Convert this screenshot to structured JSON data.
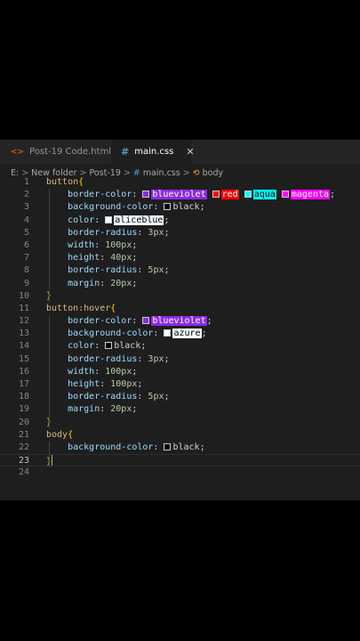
{
  "tabs": [
    {
      "icon": "<>",
      "label": "Post-19 Code.html",
      "active": false
    },
    {
      "icon": "#",
      "label": "main.css",
      "active": true,
      "close": "✕"
    }
  ],
  "breadcrumb": {
    "items": [
      "E:",
      "New folder",
      "Post-19",
      "main.css",
      "body"
    ],
    "separator": ">"
  },
  "colors": {
    "blueviolet": "#8a2be2",
    "red": "#ff0000",
    "aqua": "#00ffff",
    "magenta": "#ff00ff",
    "black": "#000000",
    "aliceblue": "#f0f8ff",
    "azure": "#f0ffff"
  },
  "code_lines": [
    {
      "n": "1",
      "tokens": [
        [
          "sel",
          "button"
        ],
        [
          "br",
          "{"
        ]
      ]
    },
    {
      "n": "2",
      "tokens": [
        [
          "ind",
          "    "
        ],
        [
          "prop",
          "border-color"
        ],
        [
          "pun",
          ": "
        ],
        [
          "color",
          "blueviolet"
        ],
        [
          "pun",
          " "
        ],
        [
          "color",
          "red"
        ],
        [
          "pun",
          " "
        ],
        [
          "color",
          "aqua"
        ],
        [
          "pun",
          " "
        ],
        [
          "color",
          "magenta"
        ],
        [
          "pun",
          ";"
        ]
      ]
    },
    {
      "n": "3",
      "tokens": [
        [
          "ind",
          "    "
        ],
        [
          "prop",
          "background-color"
        ],
        [
          "pun",
          ": "
        ],
        [
          "color",
          "black"
        ],
        [
          "pun",
          ";"
        ]
      ]
    },
    {
      "n": "4",
      "tokens": [
        [
          "ind",
          "    "
        ],
        [
          "prop",
          "color"
        ],
        [
          "pun",
          ": "
        ],
        [
          "color",
          "aliceblue"
        ],
        [
          "pun",
          ";"
        ]
      ]
    },
    {
      "n": "5",
      "tokens": [
        [
          "ind",
          "    "
        ],
        [
          "prop",
          "border-radius"
        ],
        [
          "pun",
          ": "
        ],
        [
          "num",
          "3px"
        ],
        [
          "pun",
          ";"
        ]
      ]
    },
    {
      "n": "6",
      "tokens": [
        [
          "ind",
          "    "
        ],
        [
          "prop",
          "width"
        ],
        [
          "pun",
          ": "
        ],
        [
          "num",
          "100px"
        ],
        [
          "pun",
          ";"
        ]
      ]
    },
    {
      "n": "7",
      "tokens": [
        [
          "ind",
          "    "
        ],
        [
          "prop",
          "height"
        ],
        [
          "pun",
          ": "
        ],
        [
          "num",
          "40px"
        ],
        [
          "pun",
          ";"
        ]
      ]
    },
    {
      "n": "8",
      "tokens": [
        [
          "ind",
          "    "
        ],
        [
          "prop",
          "border-radius"
        ],
        [
          "pun",
          ": "
        ],
        [
          "num",
          "5px"
        ],
        [
          "pun",
          ";"
        ]
      ]
    },
    {
      "n": "9",
      "tokens": [
        [
          "ind",
          "    "
        ],
        [
          "prop",
          "margin"
        ],
        [
          "pun",
          ": "
        ],
        [
          "num",
          "20px"
        ],
        [
          "pun",
          ";"
        ]
      ]
    },
    {
      "n": "10",
      "tokens": [
        [
          "br",
          "}"
        ]
      ]
    },
    {
      "n": "11",
      "tokens": [
        [
          "sel",
          "button:hover"
        ],
        [
          "br",
          "{"
        ]
      ]
    },
    {
      "n": "12",
      "tokens": [
        [
          "ind",
          "    "
        ],
        [
          "prop",
          "border-color"
        ],
        [
          "pun",
          ": "
        ],
        [
          "color",
          "blueviolet"
        ],
        [
          "pun",
          ";"
        ]
      ]
    },
    {
      "n": "13",
      "tokens": [
        [
          "ind",
          "    "
        ],
        [
          "prop",
          "background-color"
        ],
        [
          "pun",
          ": "
        ],
        [
          "color",
          "azure"
        ],
        [
          "pun",
          ";"
        ]
      ]
    },
    {
      "n": "14",
      "tokens": [
        [
          "ind",
          "    "
        ],
        [
          "prop",
          "color"
        ],
        [
          "pun",
          ": "
        ],
        [
          "color",
          "black"
        ],
        [
          "pun",
          ";"
        ]
      ]
    },
    {
      "n": "15",
      "tokens": [
        [
          "ind",
          "    "
        ],
        [
          "prop",
          "border-radius"
        ],
        [
          "pun",
          ": "
        ],
        [
          "num",
          "3px"
        ],
        [
          "pun",
          ";"
        ]
      ]
    },
    {
      "n": "16",
      "tokens": [
        [
          "ind",
          "    "
        ],
        [
          "prop",
          "width"
        ],
        [
          "pun",
          ": "
        ],
        [
          "num",
          "100px"
        ],
        [
          "pun",
          ";"
        ]
      ]
    },
    {
      "n": "17",
      "tokens": [
        [
          "ind",
          "    "
        ],
        [
          "prop",
          "height"
        ],
        [
          "pun",
          ": "
        ],
        [
          "num",
          "100px"
        ],
        [
          "pun",
          ";"
        ]
      ]
    },
    {
      "n": "18",
      "tokens": [
        [
          "ind",
          "    "
        ],
        [
          "prop",
          "border-radius"
        ],
        [
          "pun",
          ": "
        ],
        [
          "num",
          "5px"
        ],
        [
          "pun",
          ";"
        ]
      ]
    },
    {
      "n": "19",
      "tokens": [
        [
          "ind",
          "    "
        ],
        [
          "prop",
          "margin"
        ],
        [
          "pun",
          ": "
        ],
        [
          "num",
          "20px"
        ],
        [
          "pun",
          ";"
        ]
      ]
    },
    {
      "n": "20",
      "tokens": [
        [
          "br",
          "}"
        ]
      ]
    },
    {
      "n": "21",
      "tokens": [
        [
          "sel",
          "body"
        ],
        [
          "br",
          "{"
        ]
      ]
    },
    {
      "n": "22",
      "tokens": [
        [
          "ind",
          "    "
        ],
        [
          "prop",
          "background-color"
        ],
        [
          "pun",
          ": "
        ],
        [
          "color",
          "black"
        ],
        [
          "pun",
          ";"
        ]
      ]
    },
    {
      "n": "23",
      "tokens": [
        [
          "br",
          "}"
        ],
        [
          "cursor",
          ""
        ]
      ],
      "current": true
    },
    {
      "n": "24",
      "tokens": []
    }
  ]
}
